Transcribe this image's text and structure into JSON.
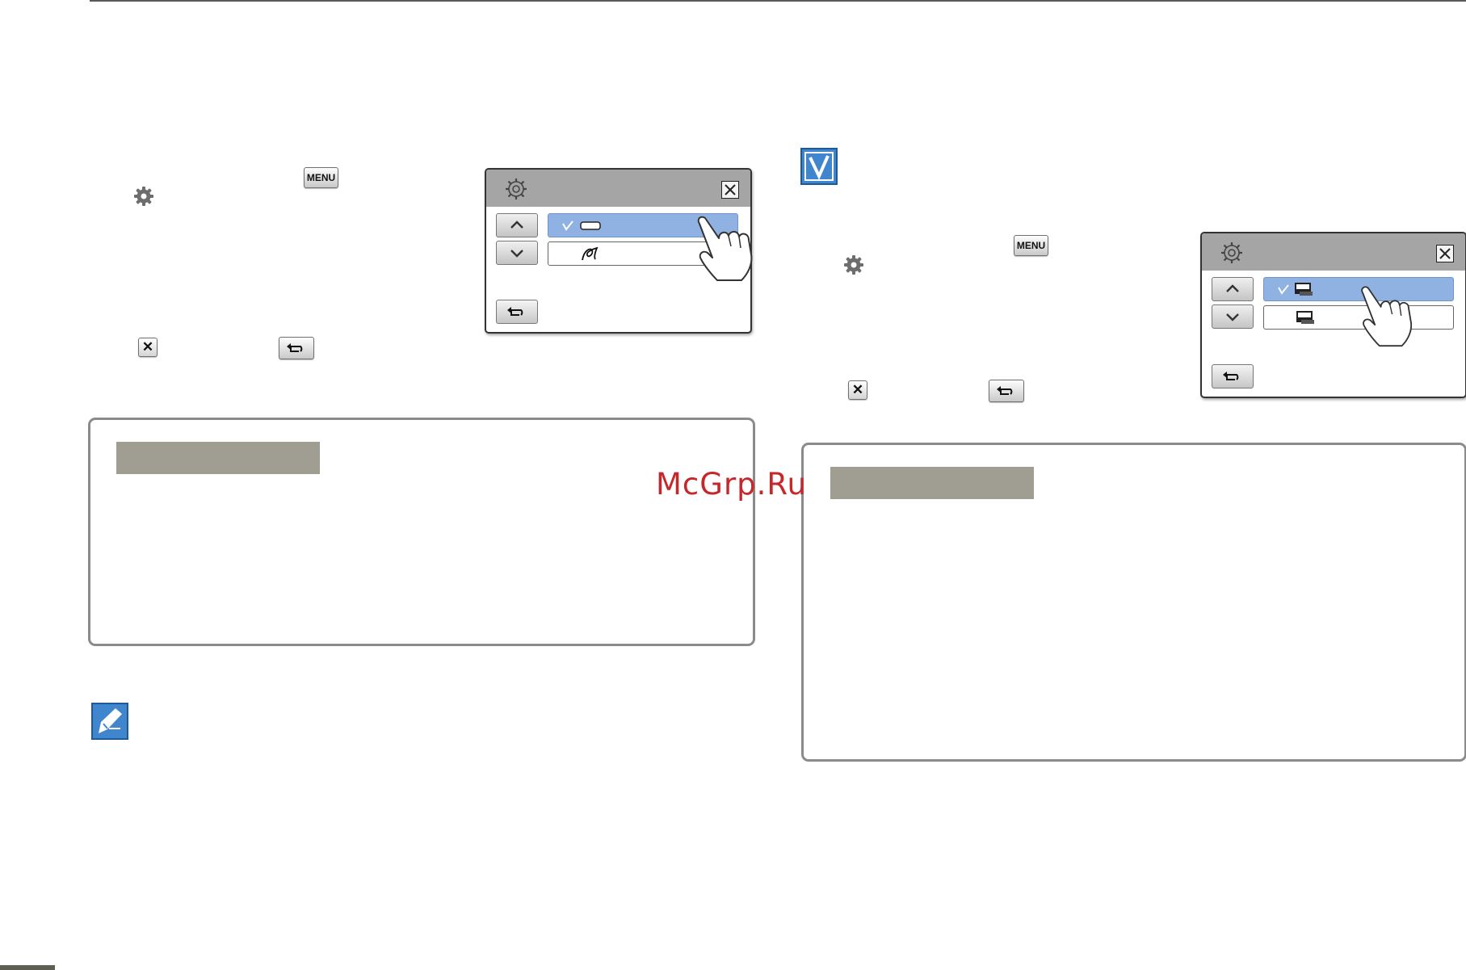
{
  "keys": {
    "menu_label": "MENU",
    "close_glyph": "✕"
  },
  "watermark": {
    "text": "McGrp.Ru"
  },
  "colors": {
    "selected_option": "#8fb2e3",
    "lcd_header": "#a5a5a5",
    "box_tab": "#a09d92",
    "watermark": "#c6272a",
    "note_icon": "#3f86cf"
  },
  "icons": {
    "left_screen_options": [
      "checkmark-icon",
      "rectangle-icon",
      "script-icon"
    ],
    "right_screen_options": [
      "checkmark-icon",
      "auto-badge-icon",
      "4800k-badge-icon"
    ]
  }
}
